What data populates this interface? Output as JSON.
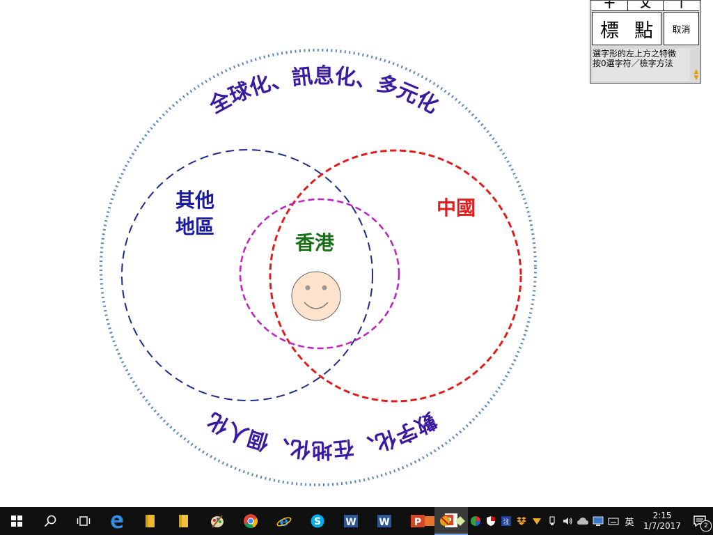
{
  "diagram": {
    "outer_arc_top": "全球化、訊息化、多元化",
    "outer_arc_bottom": "數字化、在地化、個人化",
    "label_others": [
      "其他",
      "地區"
    ],
    "label_china": "中國",
    "label_hongkong": "香港",
    "colors": {
      "outer": "#5a86b8",
      "others": "#1c2a8c",
      "china": "#e01c1c",
      "hongkong": "#c020c0",
      "arc_text": "#3a1aa0",
      "others_text": "#1a1aa0",
      "china_text": "#e01c1c",
      "hongkong_text": "#1a6e1a",
      "face_fill": "#fde2cc"
    }
  },
  "ime": {
    "top_keys": [
      "十",
      "乂",
      "丨"
    ],
    "candidates": [
      "標",
      "點"
    ],
    "cancel_label": "取消",
    "hint_line1": "選字形的左上方之特徵",
    "hint_line2": "按0選字符／檢字方法"
  },
  "taskbar": {
    "icons": [
      "windows-start-icon",
      "search-icon",
      "task-view-icon",
      "edge-icon",
      "folder-icon",
      "folder-icon",
      "paint-icon",
      "chrome-icon",
      "ie-icon",
      "skype-icon",
      "word-icon",
      "word-icon",
      "powerpoint-icon",
      "powerpoint-icon"
    ],
    "tray_icons": [
      "tray-app-icon",
      "tray-app-icon",
      "tray-app-icon",
      "tray-app-icon",
      "tray-app-icon",
      "tray-app-icon",
      "dropbox-icon",
      "tray-app-icon",
      "usb-icon",
      "speaker-icon",
      "cloud-icon",
      "network-icon",
      "keyboard-icon"
    ],
    "language": "英",
    "time": "2:15",
    "date": "1/7/2017",
    "notification_count": "2"
  }
}
